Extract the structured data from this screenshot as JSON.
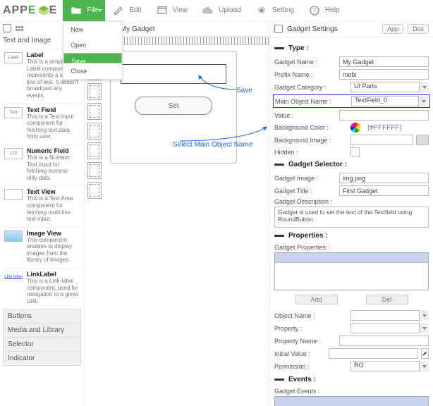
{
  "logo": {
    "pre": "APP",
    "e": "E",
    "post": "E"
  },
  "topmenu": {
    "file": "File",
    "edit": "Edit",
    "view": "View",
    "upload": "Upload",
    "setting": "Setting",
    "help": "Help",
    "dropdown": {
      "new": "New",
      "open": "Open",
      "save": "Save",
      "close": "Close"
    }
  },
  "left": {
    "category": "Text and Image",
    "components": [
      {
        "name": "Label",
        "thumb": "Label",
        "desc": "This is a simple Label component, represents a single line of text. It doesn't broadcast any events."
      },
      {
        "name": "Text Field",
        "thumb": "Text",
        "desc": "This is a Text Input component for fetching text data from user."
      },
      {
        "name": "Numeric Field",
        "thumb": "123",
        "desc": "This is a Numeric Text Input for fetching numeric only data."
      },
      {
        "name": "Text View",
        "thumb": "",
        "desc": "This is a Text Area component for fetching multi-line text input."
      },
      {
        "name": "Image View",
        "thumb": "",
        "desc": "This component enables to display images from the library of Images."
      },
      {
        "name": "LinkLabel",
        "thumb": "Link label",
        "desc": "This is a Link-label component, used for navigation to a given URL."
      }
    ],
    "accordion": [
      "Buttons",
      "Media and Library",
      "Selector",
      "Indicator"
    ]
  },
  "canvas": {
    "tab": "My Gadget",
    "set_label": "Set"
  },
  "annotations": {
    "save": "Save",
    "select_main": "Select Main Object Name"
  },
  "right": {
    "title": "Gadget Settings",
    "buttons": {
      "app": "App",
      "doc": "Doc"
    },
    "sections": {
      "type": {
        "header": "Type :",
        "gadget_name_label": "Gadget Name :",
        "gadget_name": "My Gadget",
        "prefix_label": "Prefix Name :",
        "prefix": "mobi",
        "category_label": "Gadget Category :",
        "category": "UI Parts",
        "main_obj_label": "Main Object Name :",
        "main_obj": "TextField_0",
        "value_label": "Value :",
        "value": "",
        "bgcolor_label": "Background Color :",
        "bgcolor": "(#FFFFFF)",
        "bgimage_label": "Background Image :",
        "hidden_label": "Hidden :"
      },
      "selector": {
        "header": "Gadget Selector :",
        "gimage_label": "Gadget Image :",
        "gimage": "img.png",
        "gtitle_label": "Gadget Title :",
        "gtitle": "First Gadget",
        "gdesc_label": "Gadget Description :",
        "gdesc": "Gadget is used to set the text of the Textfield using RoundButton"
      },
      "props": {
        "header": "Properties :",
        "gprops_label": "Gadget Properties :",
        "add": "Add",
        "del": "Del",
        "obj_label": "Object Name :",
        "prop_label": "Property :",
        "pname_label": "Property Name :",
        "init_label": "Initial Value :",
        "perm_label": "Permission :",
        "perm": "RO"
      },
      "events": {
        "header": "Events :",
        "gevents_label": "Gadget Events :"
      }
    }
  }
}
